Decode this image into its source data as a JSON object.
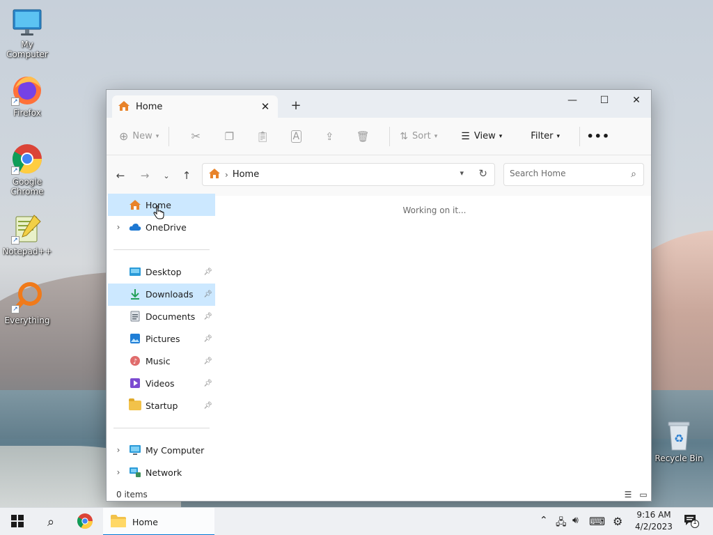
{
  "desktop": {
    "icons": [
      {
        "label": "My Computer",
        "icon": "monitor-icon"
      },
      {
        "label": "Firefox",
        "icon": "firefox-icon"
      },
      {
        "label": "Google Chrome",
        "icon": "chrome-icon"
      },
      {
        "label": "Notepad++",
        "icon": "notepadpp-icon"
      },
      {
        "label": "Everything",
        "icon": "everything-icon"
      },
      {
        "label": "Recycle Bin",
        "icon": "recycle-bin-icon"
      }
    ]
  },
  "window": {
    "tab_title": "Home",
    "toolbar": {
      "new_label": "New",
      "sort_label": "Sort",
      "view_label": "View",
      "filter_label": "Filter"
    },
    "address": {
      "crumb": "Home"
    },
    "search": {
      "placeholder": "Search Home"
    },
    "nav": {
      "top": [
        {
          "label": "Home",
          "selected": true,
          "icon": "home-icon"
        },
        {
          "label": "OneDrive",
          "icon": "cloud-icon"
        }
      ],
      "quick_access": [
        {
          "label": "Desktop",
          "icon": "desktop-folder-icon"
        },
        {
          "label": "Downloads",
          "icon": "download-icon"
        },
        {
          "label": "Documents",
          "icon": "document-icon"
        },
        {
          "label": "Pictures",
          "icon": "pictures-icon"
        },
        {
          "label": "Music",
          "icon": "music-icon"
        },
        {
          "label": "Videos",
          "icon": "videos-icon"
        },
        {
          "label": "Startup",
          "icon": "folder-icon"
        }
      ],
      "bottom": [
        {
          "label": "My Computer",
          "icon": "monitor-icon"
        },
        {
          "label": "Network",
          "icon": "network-icon"
        }
      ]
    },
    "content": {
      "status_message": "Working on it..."
    },
    "statusbar": {
      "item_count": "0 items"
    }
  },
  "taskbar": {
    "explorer_label": "Home",
    "time": "9:16 AM",
    "date": "4/2/2023",
    "notification_count": "1"
  },
  "colors": {
    "accent": "#0078d4",
    "selection": "#cce8ff",
    "home_icon": "#e8832a"
  }
}
